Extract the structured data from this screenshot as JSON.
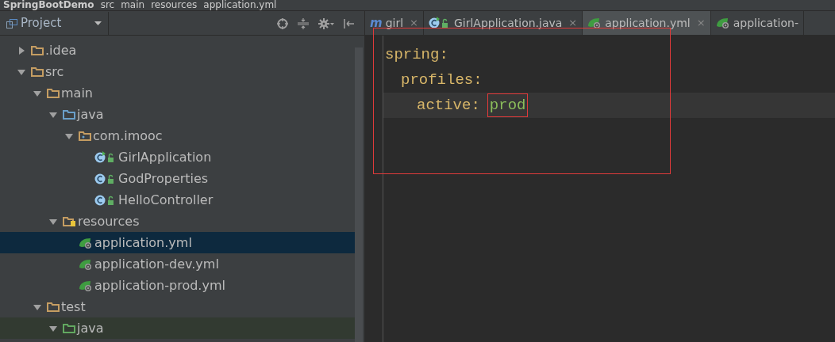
{
  "breadcrumb": [
    "SpringBootDemo",
    "src",
    "main",
    "resources",
    "application.yml"
  ],
  "project_panel": {
    "title": "Project"
  },
  "tree": [
    {
      "label": ".idea",
      "kind": "folder",
      "expanded": false,
      "selected": false
    },
    {
      "label": "src",
      "kind": "folder",
      "expanded": true,
      "selected": false,
      "children": [
        {
          "label": "main",
          "kind": "folder",
          "expanded": true,
          "selected": false,
          "children": [
            {
              "label": "java",
              "kind": "source",
              "expanded": true,
              "selected": false,
              "children": [
                {
                  "label": "com.imooc",
                  "kind": "package",
                  "expanded": true,
                  "selected": false,
                  "children": [
                    {
                      "label": "GirlApplication",
                      "kind": "spring-class",
                      "selected": false
                    },
                    {
                      "label": "GodProperties",
                      "kind": "class",
                      "selected": false
                    },
                    {
                      "label": "HelloController",
                      "kind": "class",
                      "selected": false
                    }
                  ]
                }
              ]
            },
            {
              "label": "resources",
              "kind": "resources",
              "expanded": true,
              "selected": false,
              "children": [
                {
                  "label": "application.yml",
                  "kind": "yml",
                  "selected": true
                },
                {
                  "label": "application-dev.yml",
                  "kind": "yml",
                  "selected": false
                },
                {
                  "label": "application-prod.yml",
                  "kind": "yml",
                  "selected": false
                }
              ]
            }
          ]
        },
        {
          "label": "test",
          "kind": "folder",
          "expanded": true,
          "selected": false,
          "children": [
            {
              "label": "java",
              "kind": "test",
              "expanded": true,
              "selected": false
            }
          ]
        }
      ]
    }
  ],
  "tabs": [
    {
      "label": "girl",
      "kind": "maven",
      "glyph": "m",
      "selected": false,
      "close": "×"
    },
    {
      "label": "GirlApplication.java",
      "kind": "spring-class",
      "selected": false,
      "close": "×"
    },
    {
      "label": "application.yml",
      "kind": "yml",
      "selected": true,
      "close": "×"
    },
    {
      "label": "application-",
      "kind": "yml",
      "selected": false
    }
  ],
  "editor": {
    "lines": [
      {
        "key": "spring:",
        "current": false
      },
      {
        "key": "profiles:",
        "current": false
      },
      {
        "key": "active:",
        "value": "prod",
        "current": true
      }
    ]
  }
}
